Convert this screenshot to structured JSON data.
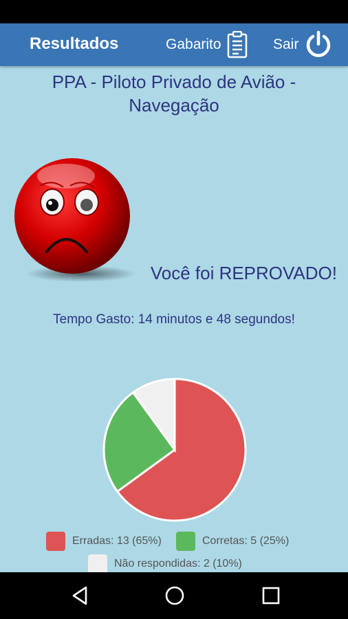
{
  "app_bar": {
    "title": "Resultados",
    "gabarito_label": "Gabarito",
    "sair_label": "Sair",
    "color": "#3a75b5"
  },
  "quiz": {
    "title": "PPA - Piloto Privado de Avião - Navegação"
  },
  "result": {
    "message": "Você foi REPROVADO!",
    "time_spent": "Tempo Gasto: 14 minutos e 48 segundos!",
    "status_icon": "sad-face-icon"
  },
  "chart_data": {
    "type": "pie",
    "slices": [
      {
        "label": "Erradas",
        "value": 13,
        "percent": 65,
        "color": "#de5454"
      },
      {
        "label": "Corretas",
        "value": 5,
        "percent": 25,
        "color": "#5cb85c"
      },
      {
        "label": "Não respondidas",
        "value": 2,
        "percent": 10,
        "color": "#f0f0f0"
      }
    ]
  },
  "legend": {
    "erradas": "Erradas: 13 (65%)",
    "corretas": "Corretas: 5 (25%)",
    "nao_respondidas": "Não respondidas: 2 (10%)"
  },
  "nav": {
    "icons": [
      "back-icon",
      "home-icon",
      "recents-icon"
    ]
  }
}
